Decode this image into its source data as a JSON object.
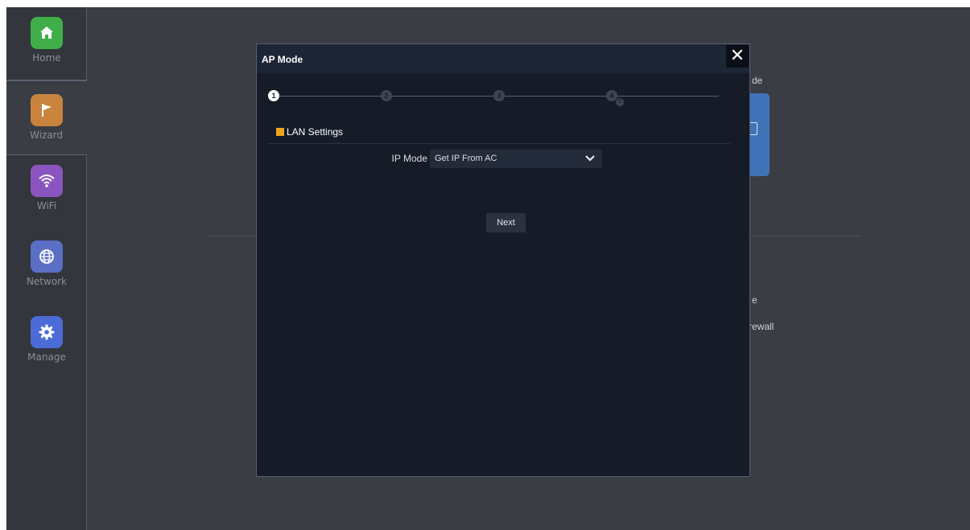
{
  "sidebar": {
    "items": [
      {
        "label": "Home",
        "icon": "home-icon",
        "color": "#3fae49"
      },
      {
        "label": "Wizard",
        "icon": "flag-icon",
        "color": "#c9833d"
      },
      {
        "label": "WiFi",
        "icon": "wifi-icon",
        "color": "#8a55c0"
      },
      {
        "label": "Network",
        "icon": "globe-icon",
        "color": "#5b6fc7"
      },
      {
        "label": "Manage",
        "icon": "gear-icon",
        "color": "#4c6bd6"
      }
    ]
  },
  "background": {
    "fragment_top": "de",
    "fragment_mid": "e",
    "fragment_firewall": "rewall"
  },
  "modal": {
    "title": "AP Mode",
    "close_glyph": "✕",
    "steps": [
      "1",
      "2",
      "3",
      "4"
    ],
    "step_badge": "5",
    "section_title": "LAN Settings",
    "ip_mode": {
      "label": "IP Mode",
      "value": "Get IP From AC"
    },
    "next_label": "Next"
  },
  "colors": {
    "accent": "#f0a31d",
    "modal_bg": "#151c28",
    "frame_bg": "#3a3d44"
  }
}
